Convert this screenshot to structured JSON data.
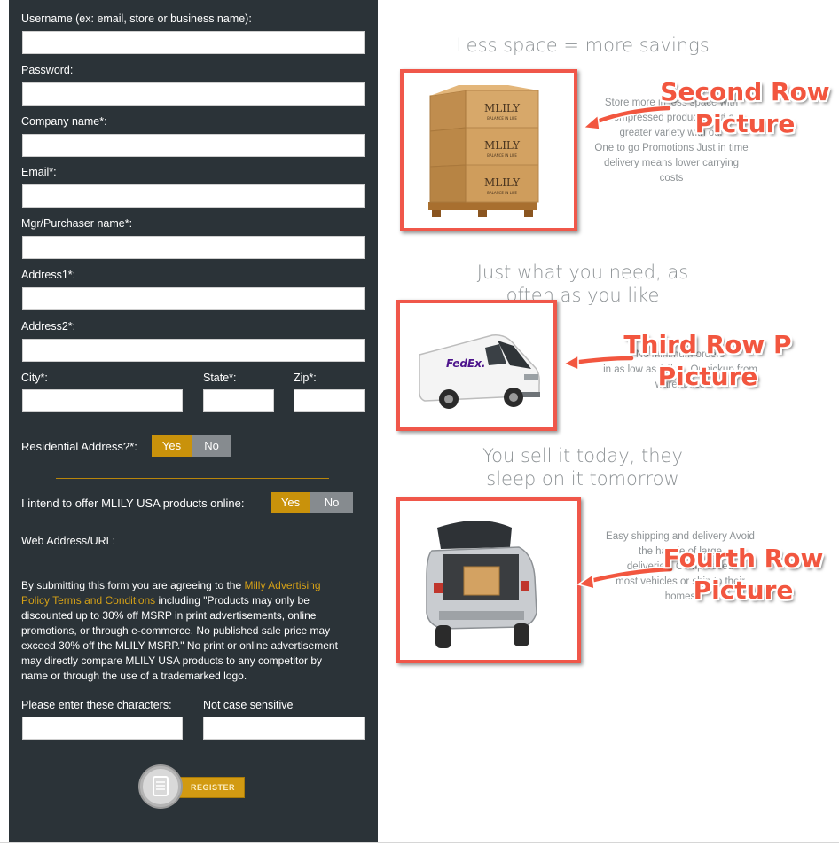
{
  "form": {
    "username_label": "Username (ex: email, store or business name):",
    "password_label": "Password:",
    "company_label": "Company name*:",
    "email_label": "Email*:",
    "mgr_label": "Mgr/Purchaser name*:",
    "address1_label": "Address1*:",
    "address2_label": "Address2*:",
    "city_label": "City*:",
    "state_label": "State*:",
    "zip_label": "Zip*:",
    "residential_label": "Residential Address?*:",
    "residential_yes": "Yes",
    "residential_no": "No",
    "online_label": "I intend to offer MLILY USA products online:",
    "online_yes": "Yes",
    "online_no": "No",
    "web_label": "Web Address/URL:",
    "terms_before": "By submitting this form you are agreeing to the ",
    "terms_link": "Milly Advertising Policy Terms and Conditions",
    "terms_after": " including \"Products may only be discounted up to 30% off MSRP in print advertisements, online promotions, or through e-commerce. No published sale price may exceed 30% off the MLILY MSRP.\" No print or online advertisement may directly compare MLILY USA products to any competitor by name or through the use of a trademarked logo.",
    "captcha_label": "Please enter these characters:",
    "case_label": "Not case sensitive",
    "register_label": "REGISTER"
  },
  "sections": [
    {
      "heading": "Less space = more savings",
      "desc_lines": [
        "Store more in less space with",
        "compressed products and a",
        "greater variety with our",
        "One to go Promotions Just in time",
        "delivery means lower carrying",
        "costs"
      ],
      "annotation_lines": [
        "Second Row",
        "Picture"
      ],
      "brand_text": "MLILY",
      "brand_sub": "BALANCE IN LIFE"
    },
    {
      "heading_lines": [
        "Just what you need, as",
        "often as you like"
      ],
      "desc_lines": [
        "No minimum orders",
        "in as low as 24hrs. Or pickup from",
        "warehouse"
      ],
      "annotation_lines": [
        "Third Row P",
        "Picture"
      ],
      "brand_text": "FedEx."
    },
    {
      "heading_lines": [
        "You sell it today, they",
        "sleep on it tomorrow"
      ],
      "desc_lines": [
        "Easy shipping and delivery Avoid",
        "the hassle of large",
        "deliveries. Compressed",
        "most vehicles or ship to their",
        "homes"
      ],
      "annotation_lines": [
        "Fourth Row",
        "Picture"
      ]
    }
  ],
  "colors": {
    "panel_bg": "#2b3338",
    "accent_gold": "#c9920b",
    "toggle_off": "#868b8f",
    "annotation_red": "#f2563f",
    "heading_gray": "#8e9396"
  }
}
